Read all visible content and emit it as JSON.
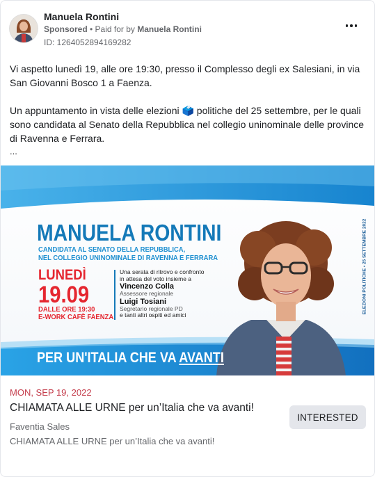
{
  "advertiser": {
    "name": "Manuela Rontini",
    "sponsored_label": "Sponsored",
    "paid_for_prefix": " • Paid for by ",
    "paid_for_by": "Manuela Rontini",
    "ad_id": "ID: 1264052894169282"
  },
  "post": {
    "paragraph_1": "Vi aspetto lunedì 19, alle ore 19:30, presso il Complesso degli ex Salesiani, in via San Giovanni Bosco 1 a Faenza.",
    "paragraph_2": "Un appuntamento in vista delle elezioni 🗳️ politiche del 25 settembre, per le quali sono candidata al Senato della Repubblica nel collegio uninominale delle province di Ravenna e Ferrara.",
    "ellipsis": "..."
  },
  "creative": {
    "headline": "MANUELA RONTINI",
    "subline_1": "CANDIDATA AL SENATO DELLA REPUBBLICA,",
    "subline_2": "NEL COLLEGIO UNINOMINALE DI RAVENNA E FERRARA",
    "day": "LUNEDÌ",
    "date": "19.09",
    "time": "DALLE ORE 19:30",
    "venue": "E-WORK CAFÈ FAENZA",
    "details_1": "Una serata di ritrovo e confronto",
    "details_2": "in attesa del voto insieme a",
    "guest_1": "Vincenzo Colla",
    "guest_1_role": "Assessore regionale",
    "guest_2": "Luigi Tosiani",
    "guest_2_role": "Segretario regionale PD",
    "details_3": "e tanti altri ospiti ed amici",
    "side_text": "ELEZIONI POLITICHE • 25 SETTEMBRE 2022",
    "slogan_prefix": "PER UN'ITALIA CHE VA ",
    "slogan_underlined": "AVANTI",
    "colors": {
      "headline_blue": "#1479b8",
      "date_red": "#e5262f",
      "band_blue": "#1a8fd6"
    }
  },
  "event": {
    "date": "MON, SEP 19, 2022",
    "title": "CHIAMATA ALLE URNE per un’Italia che va avanti!",
    "source": "Faventia Sales",
    "description": "CHIAMATA ALLE URNE per un’Italia che va avanti!",
    "interested_label": "INTERESTED"
  },
  "icons": {
    "more": "more-options-icon"
  }
}
